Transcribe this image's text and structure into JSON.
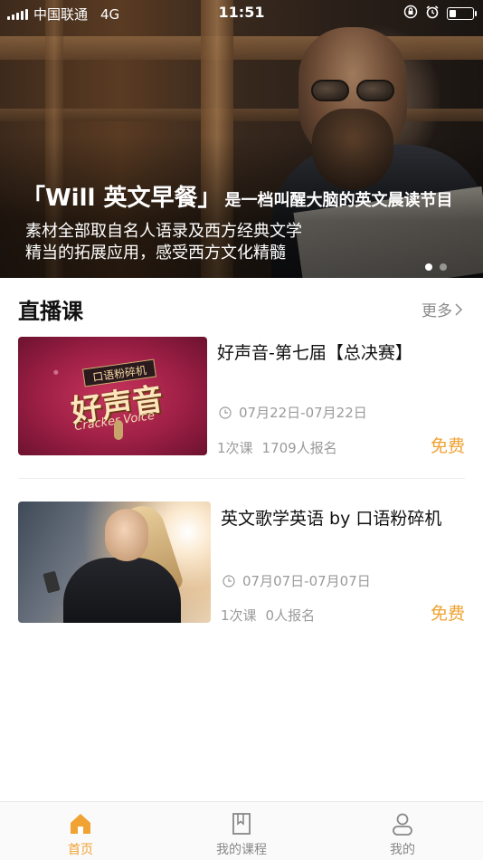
{
  "status_bar": {
    "carrier": "中国联通",
    "network": "4G",
    "time": "11:51"
  },
  "banner": {
    "title_main": "「Will 英文早餐」",
    "title_sub": "是一档叫醒大脑的英文晨读节目",
    "line1": "素材全部取自名人语录及西方经典文学",
    "line2": "精当的拓展应用，感受西方文化精髓",
    "page_count": 2,
    "active_page": 1
  },
  "live_section": {
    "title": "直播课",
    "more_label": "更多"
  },
  "courses": [
    {
      "title": "好声音-第七届【总决赛】",
      "date": "07月22日-07月22日",
      "lessons": "1次课",
      "enrolled": "1709人报名",
      "price": "免费",
      "thumb_badge": "口语粉碎机",
      "thumb_big": "好声音",
      "thumb_script": "Cracker Voice"
    },
    {
      "title": "英文歌学英语 by 口语粉碎机",
      "date": "07月07日-07月07日",
      "lessons": "1次课",
      "enrolled": "0人报名",
      "price": "免费"
    }
  ],
  "tabbar": {
    "items": [
      {
        "label": "首页",
        "icon": "home-icon",
        "active": true
      },
      {
        "label": "我的课程",
        "icon": "book-icon",
        "active": false
      },
      {
        "label": "我的",
        "icon": "user-icon",
        "active": false
      }
    ],
    "active_color": "#f0a232",
    "inactive_color": "#888888"
  },
  "colors": {
    "accent": "#f0a232",
    "secondary_text": "#9a9a9a"
  }
}
